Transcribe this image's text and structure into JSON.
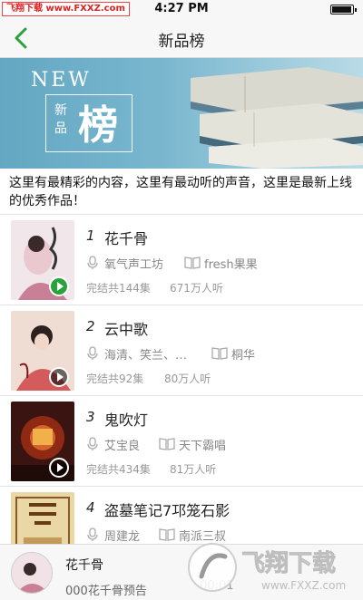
{
  "status_bar": {
    "time": "4:27 PM",
    "watermark": "飞翔下载 www.FXXZ.com"
  },
  "nav": {
    "title": "新品榜"
  },
  "banner": {
    "new_text": "NEW",
    "small_text": "新品",
    "big_text": "榜"
  },
  "intro_text": "这里有最精彩的内容，这里有最动听的声音，这里是最新上线的优秀作品！",
  "items": [
    {
      "rank": "1",
      "title": "花千骨",
      "author": "氧气声工坊",
      "anchor": "fresh果果",
      "episodes": "完结共144集",
      "plays": "671万人听",
      "playing": true
    },
    {
      "rank": "2",
      "title": "云中歌",
      "author": "海清、笑兰、…",
      "anchor": "桐华",
      "episodes": "完结共92集",
      "plays": "80万人听",
      "playing": false
    },
    {
      "rank": "3",
      "title": "鬼吹灯",
      "author": "艾宝良",
      "anchor": "天下霸唱",
      "episodes": "完结共434集",
      "plays": "81万人听",
      "playing": false
    },
    {
      "rank": "4",
      "title": "盗墓笔记7邛笼石影",
      "author": "周建龙",
      "anchor": "南派三叔",
      "episodes": "",
      "plays": "",
      "playing": false
    }
  ],
  "player": {
    "title": "花千骨",
    "subtitle": "000花千骨预告",
    "time": "00:01"
  },
  "watermark_bottom": {
    "text": "飞翔下载",
    "url": "www.FXXZ.com"
  },
  "colors": {
    "accent": "#2aa23c",
    "banner": "#6fb0c9"
  },
  "icons": {
    "back": "chevron-left-icon",
    "mic": "microphone-icon",
    "book": "book-icon",
    "play": "play-icon"
  }
}
